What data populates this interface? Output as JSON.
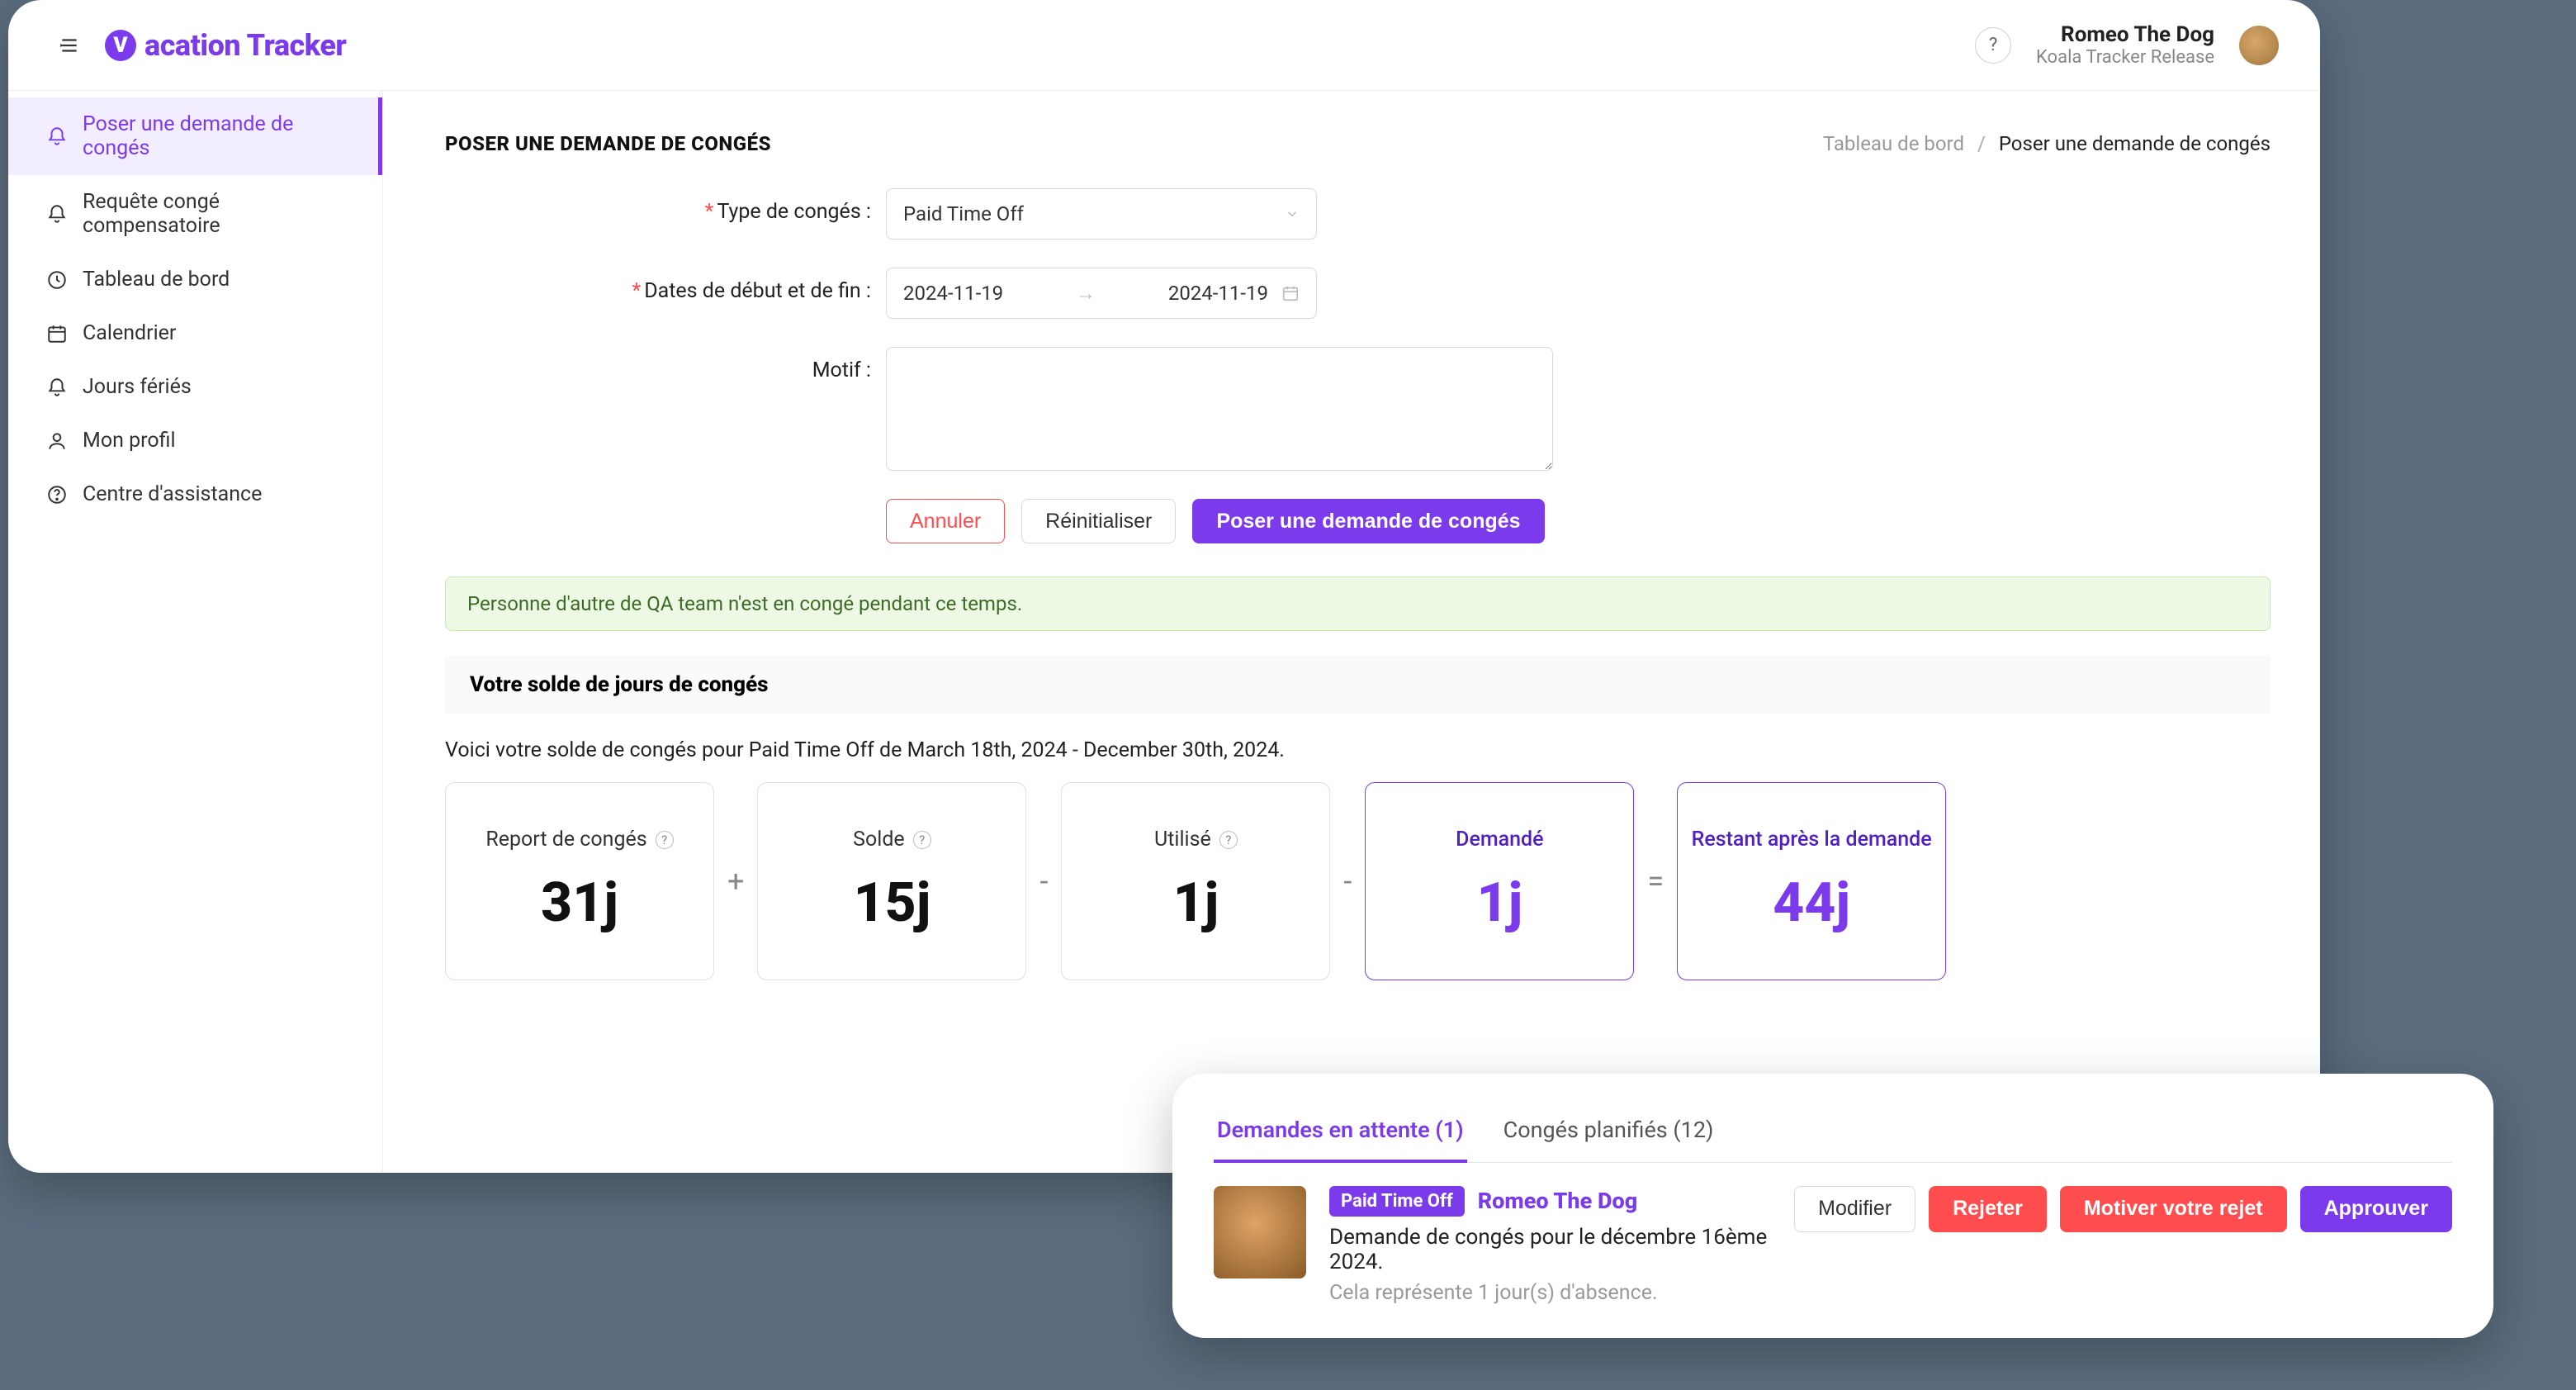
{
  "header": {
    "logo_text": "acation Tracker",
    "logo_letter": "V",
    "help_glyph": "?",
    "user_name": "Romeo The Dog",
    "user_subtitle": "Koala Tracker Release"
  },
  "sidebar": {
    "items": [
      {
        "label": "Poser une demande de congés",
        "active": true,
        "icon": "bell"
      },
      {
        "label": "Requête congé compensatoire",
        "active": false,
        "icon": "bell"
      },
      {
        "label": "Tableau de bord",
        "active": false,
        "icon": "clock"
      },
      {
        "label": "Calendrier",
        "active": false,
        "icon": "calendar"
      },
      {
        "label": "Jours fériés",
        "active": false,
        "icon": "bell"
      },
      {
        "label": "Mon profil",
        "active": false,
        "icon": "user"
      },
      {
        "label": "Centre d'assistance",
        "active": false,
        "icon": "help"
      }
    ]
  },
  "page": {
    "title": "POSER UNE DEMANDE DE CONGÉS",
    "breadcrumb_root": "Tableau de bord",
    "breadcrumb_current": "Poser une demande de congés"
  },
  "form": {
    "type_label": "Type de congés",
    "type_value": "Paid Time Off",
    "dates_label": "Dates de début et de fin",
    "date_start": "2024-11-19",
    "date_end": "2024-11-19",
    "reason_label": "Motif",
    "reason_value": "",
    "cancel_label": "Annuler",
    "reset_label": "Réinitialiser",
    "submit_label": "Poser une demande de congés"
  },
  "alert": {
    "text": "Personne d'autre de QA team n'est en congé pendant ce temps."
  },
  "quota": {
    "heading": "Votre solde de jours de congés",
    "description": "Voici votre solde de congés pour Paid Time Off de March 18th, 2024 - December 30th, 2024.",
    "cards": [
      {
        "label": "Report de congés",
        "value": "31j",
        "info": true
      },
      {
        "label": "Solde",
        "value": "15j",
        "info": true
      },
      {
        "label": "Utilisé",
        "value": "1j",
        "info": true
      },
      {
        "label": "Demandé",
        "value": "1j",
        "highlight": true
      },
      {
        "label": "Restant après la demande",
        "value": "44j",
        "highlight": true
      }
    ],
    "ops": [
      "+",
      "-",
      "-",
      "="
    ]
  },
  "pending": {
    "tab_pending": "Demandes en attente (1)",
    "tab_scheduled": "Congés planifiés (12)",
    "badge": "Paid Time Off",
    "name": "Romeo The Dog",
    "description": "Demande de congés pour le décembre 16ème 2024.",
    "meta": "Cela représente 1 jour(s) d'absence.",
    "edit_label": "Modifier",
    "reject_label": "Rejeter",
    "motive_label": "Motiver votre rejet",
    "approve_label": "Approuver"
  }
}
